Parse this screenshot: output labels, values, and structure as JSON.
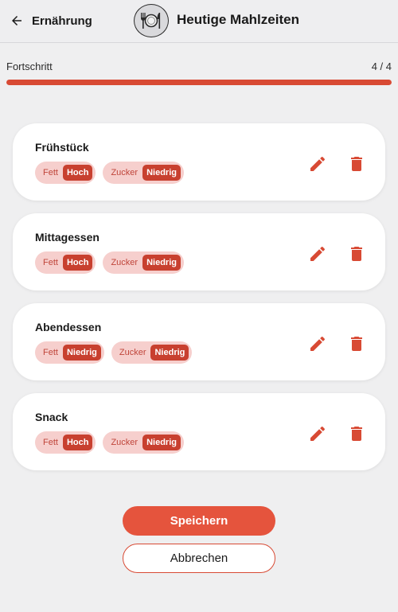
{
  "header": {
    "back_label": "Ernährung",
    "title": "Heutige Mahlzeiten",
    "logo_icon": "plate-cutlery-icon"
  },
  "progress": {
    "label": "Fortschritt",
    "count_text": "4 / 4",
    "fraction": 1.0,
    "color": "#d84a34"
  },
  "meals": [
    {
      "name": "Frühstück",
      "fat_label": "Fett",
      "fat_value": "Hoch",
      "sugar_label": "Zucker",
      "sugar_value": "Niedrig"
    },
    {
      "name": "Mittagessen",
      "fat_label": "Fett",
      "fat_value": "Hoch",
      "sugar_label": "Zucker",
      "sugar_value": "Niedrig"
    },
    {
      "name": "Abendessen",
      "fat_label": "Fett",
      "fat_value": "Niedrig",
      "sugar_label": "Zucker",
      "sugar_value": "Niedrig"
    },
    {
      "name": "Snack",
      "fat_label": "Fett",
      "fat_value": "Hoch",
      "sugar_label": "Zucker",
      "sugar_value": "Niedrig"
    }
  ],
  "actions": {
    "save_label": "Speichern",
    "cancel_label": "Abbrechen"
  },
  "colors": {
    "accent": "#e5543d",
    "tag_bg": "#f6cfcd",
    "tag_value_bg": "#c8402f"
  }
}
